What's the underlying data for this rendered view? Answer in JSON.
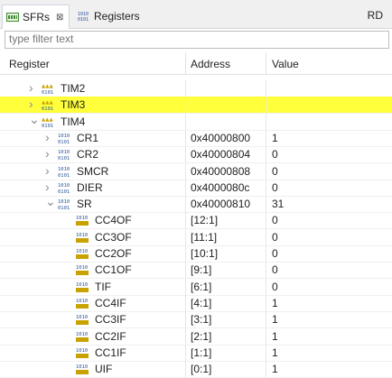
{
  "tabs": [
    {
      "label": "SFRs",
      "close": "⊠"
    },
    {
      "label": "Registers"
    }
  ],
  "top_right": "RD",
  "filter": {
    "placeholder": "type filter text"
  },
  "columns": {
    "register": "Register",
    "address": "Address",
    "value": "Value"
  },
  "rows": [
    {
      "name": "TIM2",
      "address": "",
      "value": "",
      "expander": "collapsed",
      "icon": "peripheral-group-icon",
      "depth": 1,
      "selected": false
    },
    {
      "name": "TIM3",
      "address": "",
      "value": "",
      "expander": "collapsed",
      "icon": "peripheral-group-icon",
      "depth": 1,
      "selected": true
    },
    {
      "name": "TIM4",
      "address": "",
      "value": "",
      "expander": "expanded",
      "icon": "peripheral-group-icon",
      "depth": 1,
      "selected": false
    },
    {
      "name": "CR1",
      "address": "0x40000800",
      "value": "1",
      "expander": "collapsed",
      "icon": "register-icon",
      "depth": 2,
      "selected": false
    },
    {
      "name": "CR2",
      "address": "0x40000804",
      "value": "0",
      "expander": "collapsed",
      "icon": "register-icon",
      "depth": 2,
      "selected": false
    },
    {
      "name": "SMCR",
      "address": "0x40000808",
      "value": "0",
      "expander": "collapsed",
      "icon": "register-icon",
      "depth": 2,
      "selected": false
    },
    {
      "name": "DIER",
      "address": "0x4000080c",
      "value": "0",
      "expander": "collapsed",
      "icon": "register-icon",
      "depth": 2,
      "selected": false
    },
    {
      "name": "SR",
      "address": "0x40000810",
      "value": "31",
      "expander": "expanded",
      "icon": "register-icon",
      "depth": 2,
      "selected": false
    },
    {
      "name": "CC4OF",
      "address": "[12:1]",
      "value": "0",
      "expander": "none",
      "icon": "field-icon",
      "depth": 3,
      "selected": false
    },
    {
      "name": "CC3OF",
      "address": "[11:1]",
      "value": "0",
      "expander": "none",
      "icon": "field-icon",
      "depth": 3,
      "selected": false
    },
    {
      "name": "CC2OF",
      "address": "[10:1]",
      "value": "0",
      "expander": "none",
      "icon": "field-icon",
      "depth": 3,
      "selected": false
    },
    {
      "name": "CC1OF",
      "address": "[9:1]",
      "value": "0",
      "expander": "none",
      "icon": "field-icon",
      "depth": 3,
      "selected": false
    },
    {
      "name": "TIF",
      "address": "[6:1]",
      "value": "0",
      "expander": "none",
      "icon": "field-icon",
      "depth": 3,
      "selected": false
    },
    {
      "name": "CC4IF",
      "address": "[4:1]",
      "value": "1",
      "expander": "none",
      "icon": "field-icon",
      "depth": 3,
      "selected": false
    },
    {
      "name": "CC3IF",
      "address": "[3:1]",
      "value": "1",
      "expander": "none",
      "icon": "field-icon",
      "depth": 3,
      "selected": false
    },
    {
      "name": "CC2IF",
      "address": "[2:1]",
      "value": "1",
      "expander": "none",
      "icon": "field-icon",
      "depth": 3,
      "selected": false
    },
    {
      "name": "CC1IF",
      "address": "[1:1]",
      "value": "1",
      "expander": "none",
      "icon": "field-icon",
      "depth": 3,
      "selected": false
    },
    {
      "name": "UIF",
      "address": "[0:1]",
      "value": "1",
      "expander": "none",
      "icon": "field-icon",
      "depth": 3,
      "selected": false
    }
  ],
  "colors": {
    "selection": "#ffff3b",
    "icon_blue": "#2f5597",
    "icon_gold": "#c9a200"
  }
}
